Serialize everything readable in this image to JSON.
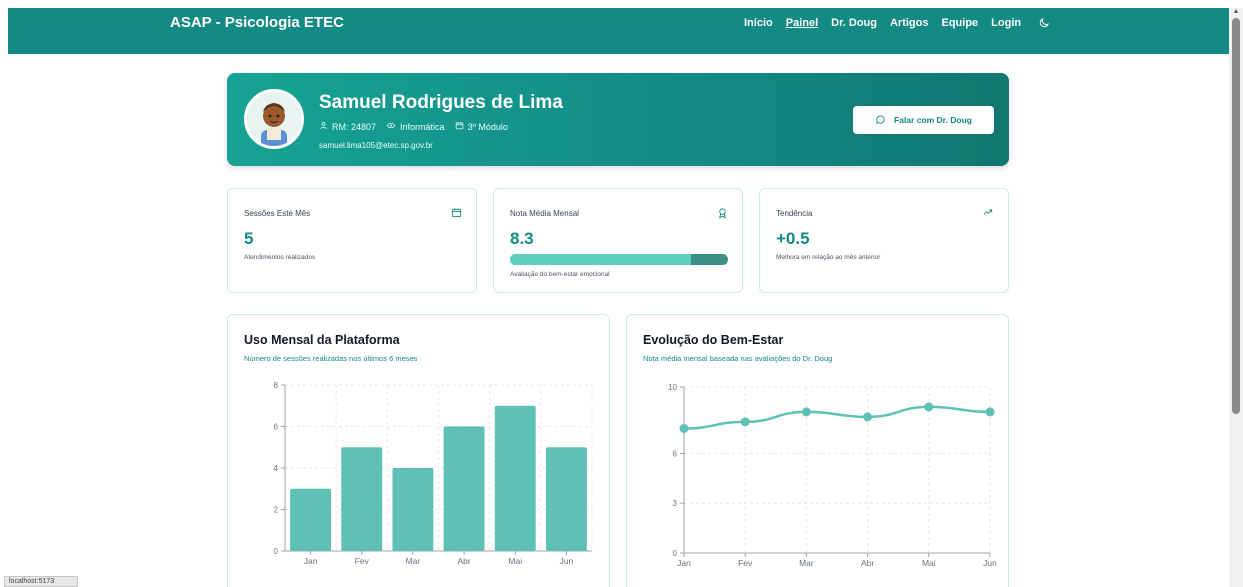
{
  "nav": {
    "brand": "ASAP - Psicologia ETEC",
    "links": [
      "Início",
      "Painel",
      "Dr. Doug",
      "Artigos",
      "Equipe",
      "Login"
    ],
    "active": "Painel",
    "theme_icon": "moon-icon"
  },
  "profile": {
    "name": "Samuel Rodrigues de Lima",
    "rm": "RM: 24807",
    "course": "Informática",
    "module": "3º Módulo",
    "email": "samuel.lima105@etec.sp.gov.br",
    "talk_button": "Falar com Dr. Doug"
  },
  "stats": {
    "sessions": {
      "title": "Sessões Este Mês",
      "value": "5",
      "sub": "Atendimentos realizados"
    },
    "grade": {
      "title": "Nota Média Mensal",
      "value": "8.3",
      "progress": 0.83,
      "sub": "Avaliação do bem-estar emocional"
    },
    "trend": {
      "title": "Tendência",
      "value": "+0.5",
      "sub": "Melhora em relação ao mês anterior"
    }
  },
  "usage_chart": {
    "title": "Uso Mensal da Plataforma",
    "subtitle": "Número de sessões realizadas nos últimos 6 meses"
  },
  "wellbeing_chart": {
    "title": "Evolução do Bem-Estar",
    "subtitle": "Nota média mensal baseada nas avaliações do Dr. Doug"
  },
  "chart_data": [
    {
      "type": "bar",
      "categories": [
        "Jan",
        "Fev",
        "Mar",
        "Abr",
        "Mai",
        "Jun"
      ],
      "values": [
        3,
        5,
        4,
        6,
        7,
        5
      ],
      "ylim": [
        0,
        8
      ],
      "yticks": [
        0,
        2,
        4,
        6,
        8
      ],
      "grid": true,
      "color": "#5fc1b5"
    },
    {
      "type": "line",
      "categories": [
        "Jan",
        "Fev",
        "Mar",
        "Abr",
        "Mai",
        "Jun"
      ],
      "values": [
        7.5,
        7.9,
        8.5,
        8.2,
        8.8,
        8.5
      ],
      "ylim": [
        0,
        10
      ],
      "yticks": [
        0,
        3,
        6,
        10
      ],
      "grid": true,
      "color": "#5fc1b5"
    }
  ],
  "status_url": "localhost:5173"
}
